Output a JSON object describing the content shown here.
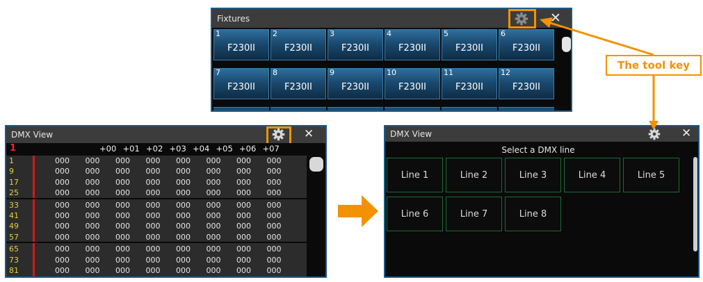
{
  "fixtures": {
    "title": "Fixtures",
    "tiles": [
      {
        "num": "1",
        "name": "F230II"
      },
      {
        "num": "2",
        "name": "F230II"
      },
      {
        "num": "3",
        "name": "F230II"
      },
      {
        "num": "4",
        "name": "F230II"
      },
      {
        "num": "5",
        "name": "F230II"
      },
      {
        "num": "6",
        "name": "F230II"
      },
      {
        "num": "7",
        "name": "F230II"
      },
      {
        "num": "8",
        "name": "F230II"
      },
      {
        "num": "9",
        "name": "F230II"
      },
      {
        "num": "10",
        "name": "F230II"
      },
      {
        "num": "11",
        "name": "F230II"
      },
      {
        "num": "12",
        "name": "F230II"
      }
    ]
  },
  "dmx_left": {
    "title": "DMX View",
    "line_number": "1",
    "offsets": [
      "+00",
      "+01",
      "+02",
      "+03",
      "+04",
      "+05",
      "+06",
      "+07"
    ],
    "addresses": [
      "1",
      "9",
      "17",
      "25",
      "33",
      "41",
      "49",
      "57",
      "65",
      "73",
      "81"
    ],
    "cell_value": "000"
  },
  "dmx_right": {
    "title": "DMX View",
    "prompt": "Select a DMX line",
    "lines": [
      "Line 1",
      "Line 2",
      "Line 3",
      "Line 4",
      "Line 5",
      "Line 6",
      "Line 7",
      "Line 8"
    ]
  },
  "annotation": {
    "label": "The tool key"
  },
  "colors": {
    "accent": "#f39200",
    "tile_blue": "#1a4a70",
    "line_border": "#1e6b36",
    "address_yellow": "#e0d040"
  },
  "icons": [
    "gear-icon",
    "close-icon",
    "arrow-right-icon"
  ]
}
